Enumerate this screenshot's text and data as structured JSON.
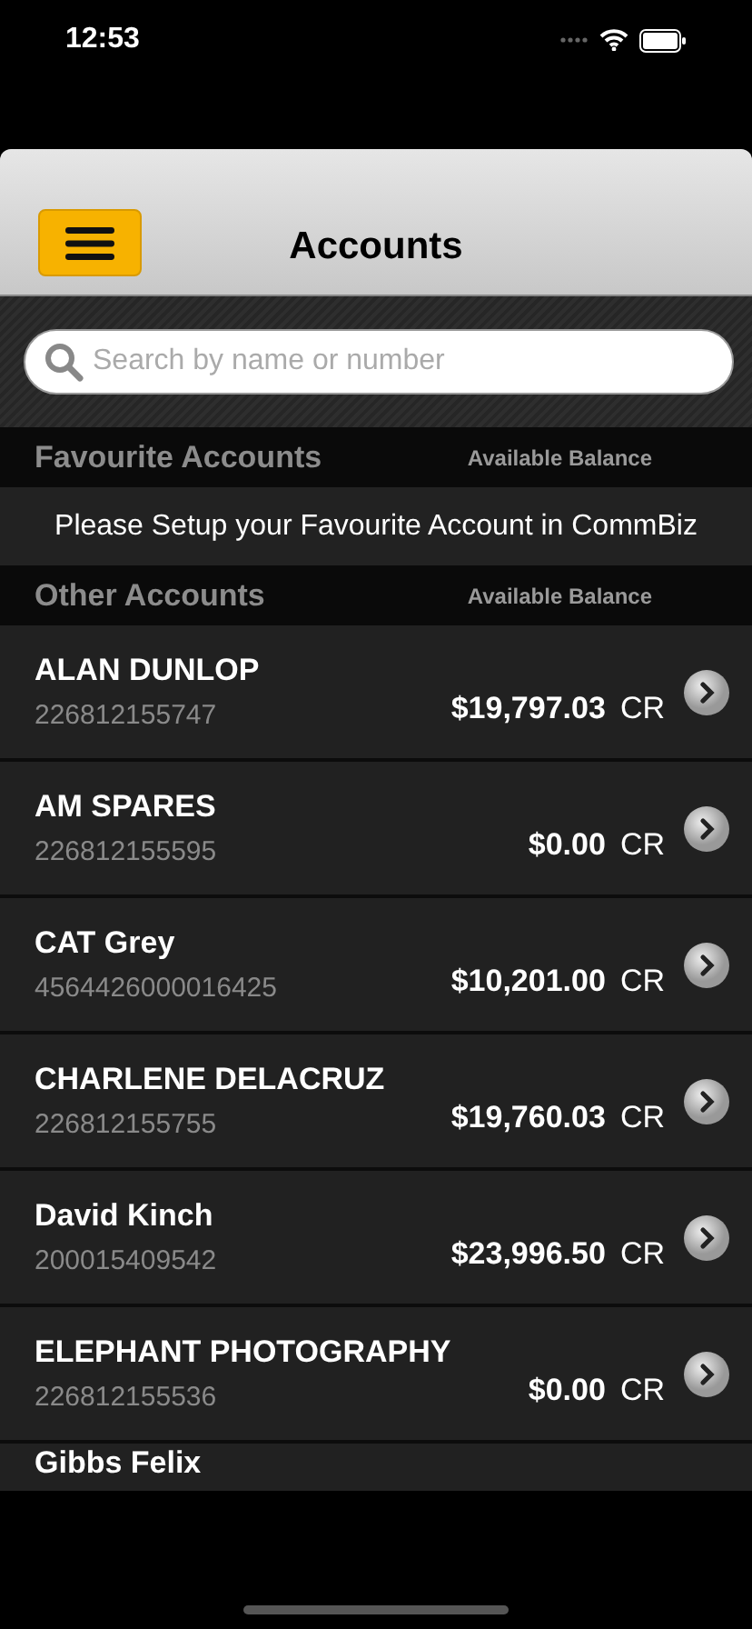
{
  "status_bar": {
    "time": "12:53"
  },
  "header": {
    "title": "Accounts"
  },
  "search": {
    "placeholder": "Search by name or number"
  },
  "favourites": {
    "title": "Favourite Accounts",
    "column": "Available Balance",
    "message": "Please Setup your Favourite Account in CommBiz"
  },
  "others": {
    "title": "Other Accounts",
    "column": "Available Balance"
  },
  "accounts": [
    {
      "name": "ALAN DUNLOP",
      "number": "226812155747",
      "balance": "$19,797.03",
      "suffix": "CR"
    },
    {
      "name": "AM SPARES",
      "number": "226812155595",
      "balance": "$0.00",
      "suffix": "CR"
    },
    {
      "name": "CAT Grey",
      "number": "4564426000016425",
      "balance": "$10,201.00",
      "suffix": "CR"
    },
    {
      "name": "CHARLENE DELACRUZ",
      "number": "226812155755",
      "balance": "$19,760.03",
      "suffix": "CR"
    },
    {
      "name": "David Kinch",
      "number": "200015409542",
      "balance": "$23,996.50",
      "suffix": "CR"
    },
    {
      "name": "ELEPHANT PHOTOGRAPHY",
      "number": "226812155536",
      "balance": "$0.00",
      "suffix": "CR"
    },
    {
      "name": "Gibbs Felix"
    }
  ]
}
